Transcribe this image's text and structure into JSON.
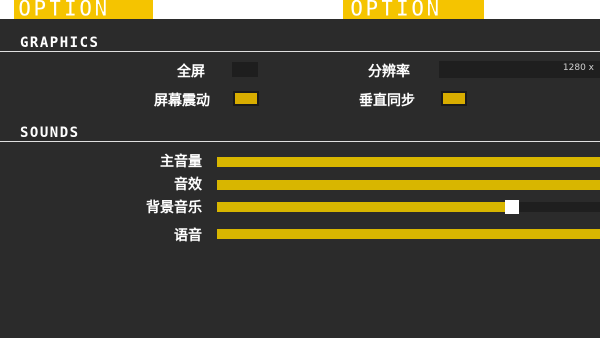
{
  "banner": {
    "title_left": "OPTION",
    "title_right": "OPTION"
  },
  "graphics": {
    "section_title": "GRAPHICS",
    "fullscreen": {
      "label": "全屏",
      "enabled": false
    },
    "resolution": {
      "label": "分辨率",
      "value": "1280 x"
    },
    "screen_shake": {
      "label": "屏幕震动",
      "enabled": true
    },
    "vsync": {
      "label": "垂直同步",
      "enabled": true
    }
  },
  "sounds": {
    "section_title": "SOUNDS",
    "master_volume": {
      "label": "主音量",
      "level": 1.0
    },
    "sfx": {
      "label": "音效",
      "level": 1.0
    },
    "music": {
      "label": "背景音乐",
      "level": 0.77
    },
    "voice": {
      "label": "语音",
      "level": 1.0
    }
  },
  "colors": {
    "accent": "#f5c400",
    "slider_fill": "#d8b600",
    "background": "#2b2b2b"
  }
}
